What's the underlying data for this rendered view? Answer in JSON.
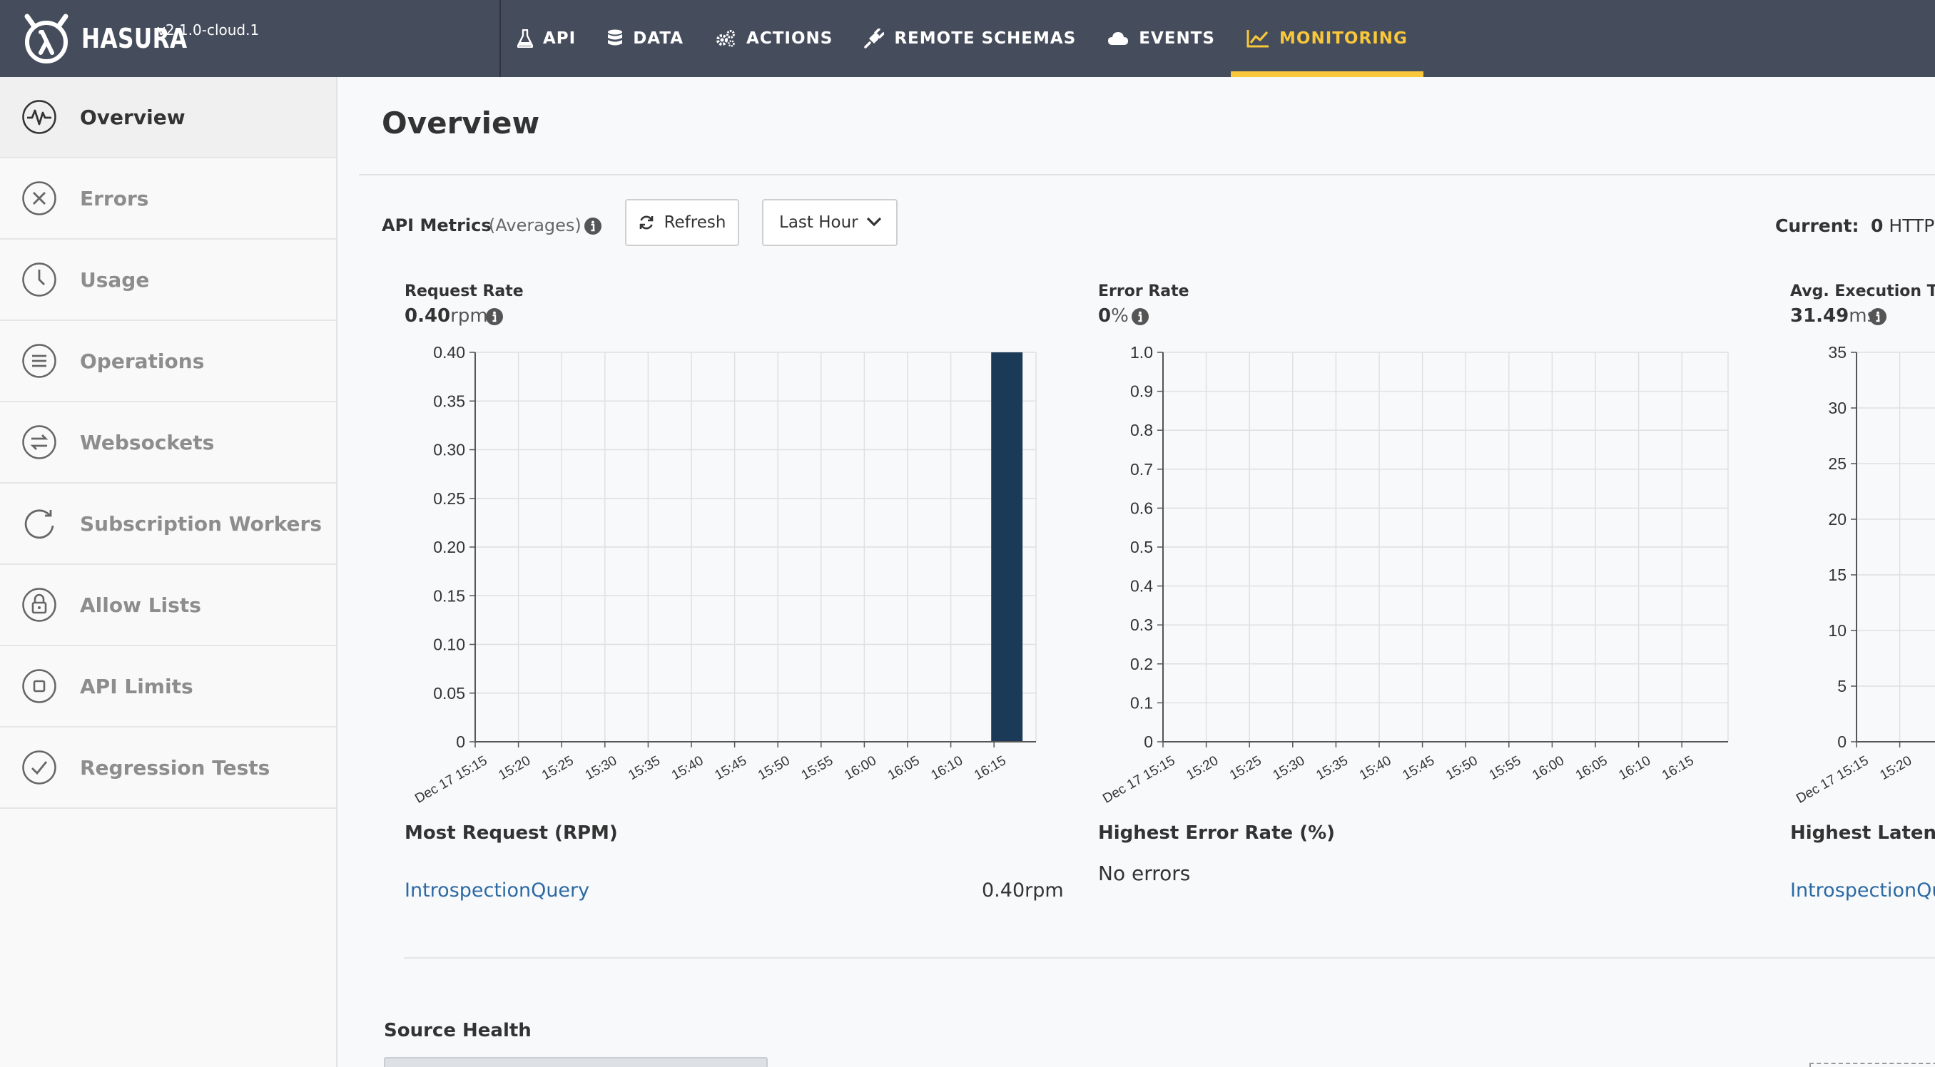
{
  "brand": {
    "name": "HASURA",
    "version": "v2.1.0-cloud.1"
  },
  "nav": [
    {
      "label": "API",
      "icon": "flask-icon",
      "active": false
    },
    {
      "label": "DATA",
      "icon": "database-icon",
      "active": false
    },
    {
      "label": "ACTIONS",
      "icon": "gears-icon",
      "active": false
    },
    {
      "label": "REMOTE SCHEMAS",
      "icon": "plug-icon",
      "active": false
    },
    {
      "label": "EVENTS",
      "icon": "cloud-icon",
      "active": false
    },
    {
      "label": "MONITORING",
      "icon": "line-chart-icon",
      "active": true
    }
  ],
  "sidebar": {
    "items": [
      {
        "label": "Overview",
        "icon": "pulse-icon",
        "active": true
      },
      {
        "label": "Errors",
        "icon": "x-circle-icon",
        "active": false
      },
      {
        "label": "Usage",
        "icon": "clock-icon",
        "active": false
      },
      {
        "label": "Operations",
        "icon": "list-icon",
        "active": false
      },
      {
        "label": "Websockets",
        "icon": "exchange-icon",
        "active": false
      },
      {
        "label": "Subscription Workers",
        "icon": "refresh-icon",
        "active": false
      },
      {
        "label": "Allow Lists",
        "icon": "lock-icon",
        "active": false
      },
      {
        "label": "API Limits",
        "icon": "square-icon",
        "active": false
      },
      {
        "label": "Regression Tests",
        "icon": "check-icon",
        "active": false
      }
    ]
  },
  "main": {
    "title": "Overview",
    "metrics_label": "API Metrics",
    "metrics_sub": "(Averages)",
    "refresh_label": "Refresh",
    "range_selected": "Last Hour",
    "current_label": "Current:",
    "current_value": "0",
    "current_unit": "HTTP"
  },
  "charts": [
    {
      "title": "Request Rate",
      "value": "0.40",
      "unit": "rpm"
    },
    {
      "title": "Error Rate",
      "value": "0",
      "unit": "%"
    },
    {
      "title": "Avg. Execution Time",
      "value": "31.49",
      "unit": "ms"
    }
  ],
  "chart_data": [
    {
      "type": "bar",
      "title": "Request Rate",
      "x": [
        "Dec 17 15:15",
        "15:20",
        "15:25",
        "15:30",
        "15:35",
        "15:40",
        "15:45",
        "15:50",
        "15:55",
        "16:00",
        "16:05",
        "16:10",
        "16:15"
      ],
      "yticks": [
        "0",
        "0.05",
        "0.10",
        "0.15",
        "0.20",
        "0.25",
        "0.30",
        "0.35",
        "0.40"
      ],
      "ylim": [
        0,
        0.4
      ],
      "bars": [
        {
          "x": "16:15",
          "value": 0.4
        }
      ],
      "bar_color": "#1b3a57",
      "grid": true
    },
    {
      "type": "line",
      "title": "Error Rate",
      "x": [
        "Dec 17 15:15",
        "15:20",
        "15:25",
        "15:30",
        "15:35",
        "15:40",
        "15:45",
        "15:50",
        "15:55",
        "16:00",
        "16:05",
        "16:10",
        "16:15"
      ],
      "yticks": [
        "0",
        "0.1",
        "0.2",
        "0.3",
        "0.4",
        "0.5",
        "0.6",
        "0.7",
        "0.8",
        "0.9",
        "1.0"
      ],
      "ylim": [
        0,
        1.0
      ],
      "series": [],
      "grid": true
    },
    {
      "type": "bar",
      "title": "Avg. Execution Time",
      "x": [
        "Dec 17 15:15",
        "15:20"
      ],
      "yticks": [
        "0",
        "5",
        "10",
        "15",
        "20",
        "25",
        "30",
        "35"
      ],
      "ylim": [
        0,
        35
      ],
      "bars": [],
      "grid": true
    }
  ],
  "panels": {
    "most_request": {
      "heading": "Most Request (RPM)",
      "op": "IntrospectionQuery",
      "value": "0.40rpm"
    },
    "highest_error": {
      "heading": "Highest Error Rate (%)",
      "empty": "No errors"
    },
    "highest_latency": {
      "heading": "Highest Latency (",
      "op": "IntrospectionQu"
    }
  },
  "source_health": {
    "heading": "Source Health"
  }
}
